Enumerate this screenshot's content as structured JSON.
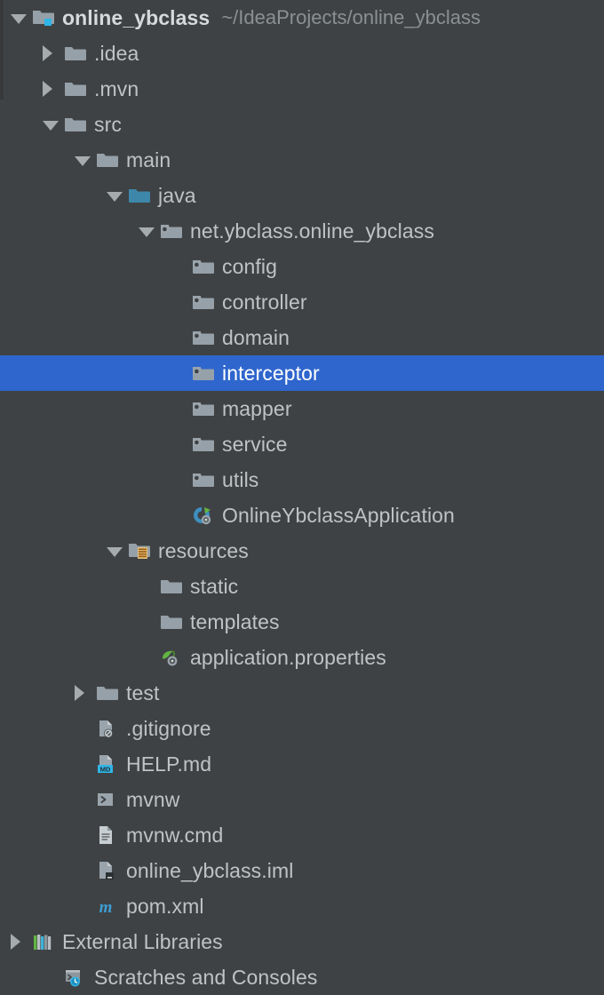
{
  "window": {
    "title": "Project tool window",
    "theme": "darcula",
    "background_color": "#3f4244",
    "selection_color": "#2f66cd",
    "text_color": "#bfc3c5",
    "muted_text_color": "#8b9092"
  },
  "tree": {
    "nodes": [
      {
        "label": "online_ybclass",
        "secondary": "~/IdeaProjects/online_ybclass",
        "depth": 0,
        "toggle": "down",
        "icon": "project-module-folder-icon",
        "selected": false,
        "bold": true
      },
      {
        "label": ".idea",
        "secondary": "",
        "depth": 1,
        "toggle": "right",
        "icon": "folder-icon",
        "selected": false,
        "bold": false
      },
      {
        "label": ".mvn",
        "secondary": "",
        "depth": 1,
        "toggle": "right",
        "icon": "folder-icon",
        "selected": false,
        "bold": false
      },
      {
        "label": "src",
        "secondary": "",
        "depth": 1,
        "toggle": "down",
        "icon": "folder-icon",
        "selected": false,
        "bold": false
      },
      {
        "label": "main",
        "secondary": "",
        "depth": 2,
        "toggle": "down",
        "icon": "folder-icon",
        "selected": false,
        "bold": false
      },
      {
        "label": "java",
        "secondary": "",
        "depth": 3,
        "toggle": "down",
        "icon": "source-root-folder-icon",
        "selected": false,
        "bold": false
      },
      {
        "label": "net.ybclass.online_ybclass",
        "secondary": "",
        "depth": 4,
        "toggle": "down",
        "icon": "package-icon",
        "selected": false,
        "bold": false
      },
      {
        "label": "config",
        "secondary": "",
        "depth": 5,
        "toggle": "none",
        "icon": "package-icon",
        "selected": false,
        "bold": false
      },
      {
        "label": "controller",
        "secondary": "",
        "depth": 5,
        "toggle": "none",
        "icon": "package-icon",
        "selected": false,
        "bold": false
      },
      {
        "label": "domain",
        "secondary": "",
        "depth": 5,
        "toggle": "none",
        "icon": "package-icon",
        "selected": false,
        "bold": false
      },
      {
        "label": "interceptor",
        "secondary": "",
        "depth": 5,
        "toggle": "none",
        "icon": "package-icon",
        "selected": true,
        "bold": false
      },
      {
        "label": "mapper",
        "secondary": "",
        "depth": 5,
        "toggle": "none",
        "icon": "package-icon",
        "selected": false,
        "bold": false
      },
      {
        "label": "service",
        "secondary": "",
        "depth": 5,
        "toggle": "none",
        "icon": "package-icon",
        "selected": false,
        "bold": false
      },
      {
        "label": "utils",
        "secondary": "",
        "depth": 5,
        "toggle": "none",
        "icon": "package-icon",
        "selected": false,
        "bold": false
      },
      {
        "label": "OnlineYbclassApplication",
        "secondary": "",
        "depth": 5,
        "toggle": "none",
        "icon": "spring-boot-application-class-icon",
        "selected": false,
        "bold": false
      },
      {
        "label": "resources",
        "secondary": "",
        "depth": 3,
        "toggle": "down",
        "icon": "resource-root-folder-icon",
        "selected": false,
        "bold": false
      },
      {
        "label": "static",
        "secondary": "",
        "depth": 4,
        "toggle": "none",
        "icon": "folder-icon",
        "selected": false,
        "bold": false
      },
      {
        "label": "templates",
        "secondary": "",
        "depth": 4,
        "toggle": "none",
        "icon": "folder-icon",
        "selected": false,
        "bold": false
      },
      {
        "label": "application.properties",
        "secondary": "",
        "depth": 4,
        "toggle": "none",
        "icon": "spring-properties-icon",
        "selected": false,
        "bold": false
      },
      {
        "label": "test",
        "secondary": "",
        "depth": 2,
        "toggle": "right",
        "icon": "folder-icon",
        "selected": false,
        "bold": false
      },
      {
        "label": ".gitignore",
        "secondary": "",
        "depth": 2,
        "toggle": "none",
        "icon": "gitignore-file-icon",
        "selected": false,
        "bold": false
      },
      {
        "label": "HELP.md",
        "secondary": "",
        "depth": 2,
        "toggle": "none",
        "icon": "markdown-file-icon",
        "selected": false,
        "bold": false
      },
      {
        "label": "mvnw",
        "secondary": "",
        "depth": 2,
        "toggle": "none",
        "icon": "shell-script-icon",
        "selected": false,
        "bold": false
      },
      {
        "label": "mvnw.cmd",
        "secondary": "",
        "depth": 2,
        "toggle": "none",
        "icon": "text-file-icon",
        "selected": false,
        "bold": false
      },
      {
        "label": "online_ybclass.iml",
        "secondary": "",
        "depth": 2,
        "toggle": "none",
        "icon": "iml-module-file-icon",
        "selected": false,
        "bold": false
      },
      {
        "label": "pom.xml",
        "secondary": "",
        "depth": 2,
        "toggle": "none",
        "icon": "maven-pom-icon",
        "selected": false,
        "bold": false
      },
      {
        "label": "External Libraries",
        "secondary": "",
        "depth": 0,
        "toggle": "right",
        "icon": "external-libraries-icon",
        "selected": false,
        "bold": false
      },
      {
        "label": "Scratches and Consoles",
        "secondary": "",
        "depth": 1,
        "toggle": "none",
        "icon": "scratches-consoles-icon",
        "selected": false,
        "bold": false
      }
    ]
  }
}
